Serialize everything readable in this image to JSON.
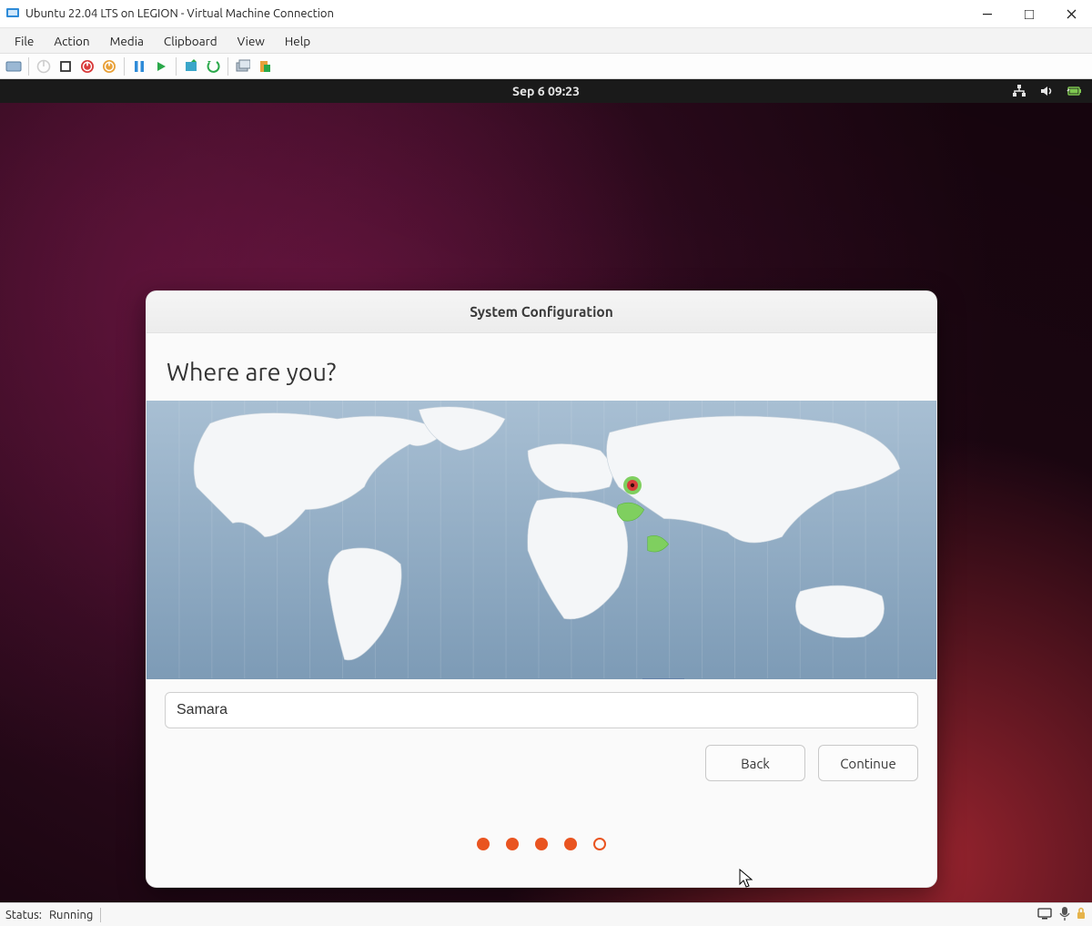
{
  "window": {
    "title": "Ubuntu 22.04 LTS on LEGION - Virtual Machine Connection",
    "menus": [
      "File",
      "Action",
      "Media",
      "Clipboard",
      "View",
      "Help"
    ]
  },
  "gnome": {
    "clock": "Sep 6  09:23"
  },
  "installer": {
    "title": "System Configuration",
    "heading": "Where are you?",
    "location_value": "Samara",
    "back_label": "Back",
    "continue_label": "Continue",
    "step_current": 4,
    "step_total": 5
  },
  "statusbar": {
    "label": "Status:",
    "value": "Running"
  }
}
